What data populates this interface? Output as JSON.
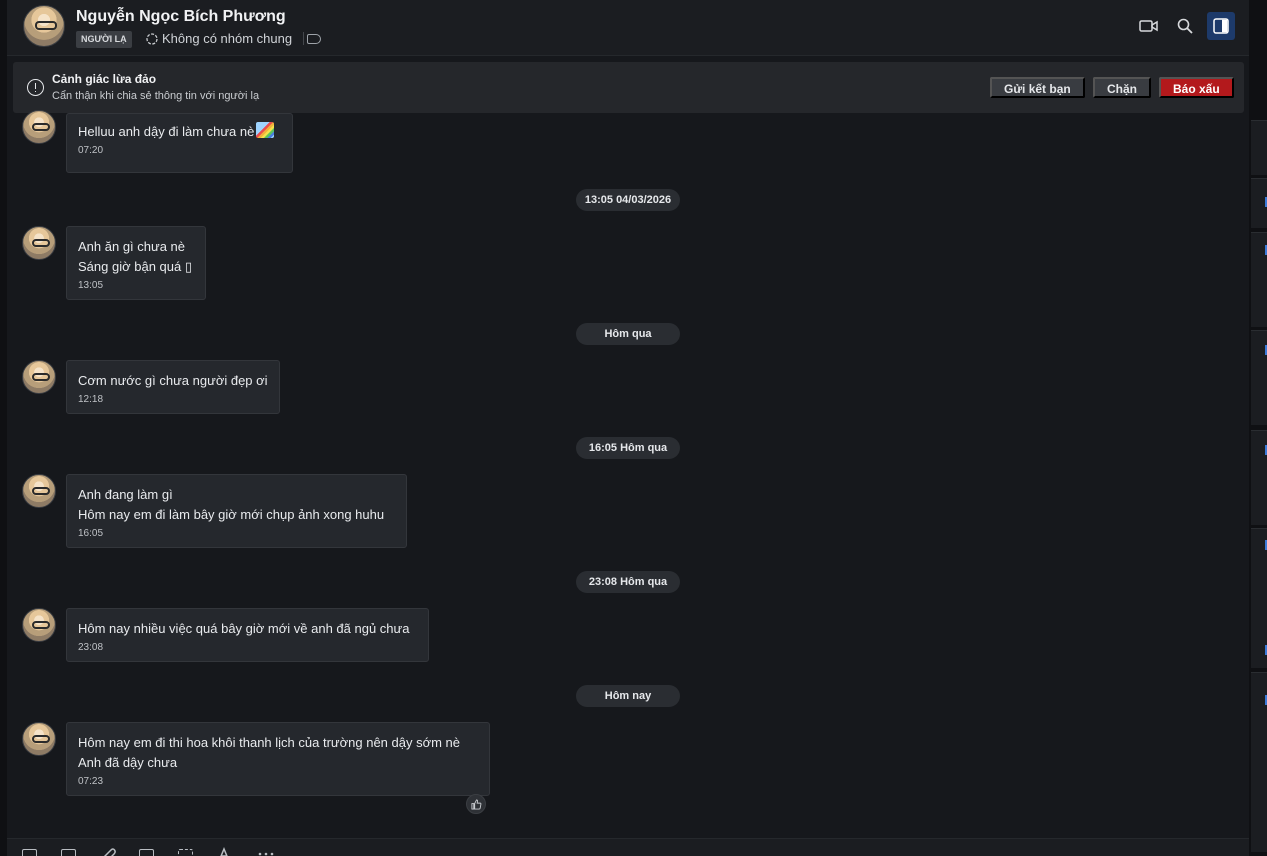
{
  "header": {
    "name": "Nguyễn Ngọc Bích Phương",
    "badge": "NGƯỜI LẠ",
    "group_info": "Không có nhóm chung"
  },
  "warning": {
    "title": "Cảnh giác lừa đảo",
    "subtitle": "Cẩn thận khi chia sẻ thông tin với người lạ",
    "add_friend": "Gửi kết bạn",
    "block": "Chặn",
    "report": "Báo xấu"
  },
  "messages": [
    {
      "lines": [
        "Helluu anh dậy đi làm chưa nè"
      ],
      "time": "07:20",
      "emoji": "rainbow"
    },
    {
      "lines": [
        "Anh ăn gì chưa nè",
        "Sáng giờ bận quá ▯"
      ],
      "time": "13:05"
    },
    {
      "lines": [
        "Cơm nước gì chưa người đẹp ơi"
      ],
      "time": "12:18"
    },
    {
      "lines": [
        "Anh đang làm gì",
        "Hôm nay em đi làm bây giờ mới chụp ảnh xong huhu"
      ],
      "time": "16:05"
    },
    {
      "lines": [
        "Hôm nay nhiều việc quá bây giờ mới về anh đã ngủ chưa"
      ],
      "time": "23:08"
    },
    {
      "lines": [
        "Hôm nay em đi thi hoa khôi thanh lịch của trường  nên dậy sớm nè",
        "Anh đã dậy chưa"
      ],
      "time": "07:23"
    }
  ],
  "dividers": [
    "13:05 04/03/2026",
    "Hôm qua",
    "16:05 Hôm qua",
    "23:08 Hôm qua",
    "Hôm nay"
  ],
  "icons": {
    "video_call": "video-camera-icon",
    "search": "search-icon",
    "sidebar_toggle": "sidebar-panel-icon",
    "like": "thumbs-up-icon"
  },
  "colors": {
    "report_button": "#b3191c",
    "active_toggle": "#1d3a6a",
    "bubble_bg": "#25282d"
  }
}
